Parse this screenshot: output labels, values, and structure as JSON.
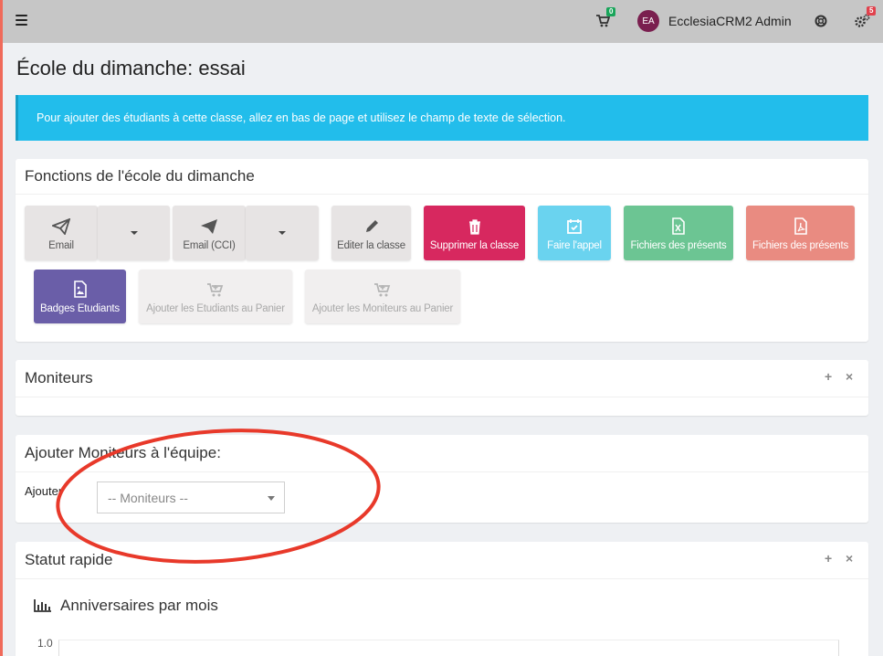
{
  "topbar": {
    "cart_count": "0",
    "user_initials": "EA",
    "user_name": "EcclesiaCRM2 Admin",
    "settings_count": "5"
  },
  "page": {
    "title": "École du dimanche: essai"
  },
  "alert": {
    "text": "Pour ajouter des étudiants à cette classe, allez en bas de page et utilisez le champ de texte de sélection."
  },
  "functions_box": {
    "title": "Fonctions de l'école du dimanche",
    "buttons": {
      "email": "Email",
      "email_bcc": "Email (CCI)",
      "edit_class": "Editer la classe",
      "delete_class": "Supprimer la classe",
      "attendance": "Faire l'appel",
      "attendance_excel": "Fichiers des présents",
      "attendance_pdf": "Fichiers des présents",
      "student_badges": "Badges Etudiants",
      "add_students_cart": "Ajouter les Etudiants au Panier",
      "add_teachers_cart": "Ajouter les Moniteurs au Panier"
    }
  },
  "teachers_box": {
    "title": "Moniteurs"
  },
  "add_teachers_box": {
    "title": "Ajouter Moniteurs à l'équipe:",
    "add_label": "Ajouter",
    "select_value": "-- Moniteurs --"
  },
  "quick_status_box": {
    "title": "Statut rapide",
    "chart_title": "Anniversaires par mois"
  },
  "colors": {
    "alert": "#22bdeb",
    "danger": "#d7285f",
    "info": "#6ad3ef",
    "success": "#6cc593",
    "pdf": "#e98b81",
    "purple": "#6a5ea8",
    "annotation": "#e8392a"
  },
  "chart_data": {
    "type": "bar",
    "title": "Anniversaires par mois",
    "ytick_visible": "1.0"
  }
}
